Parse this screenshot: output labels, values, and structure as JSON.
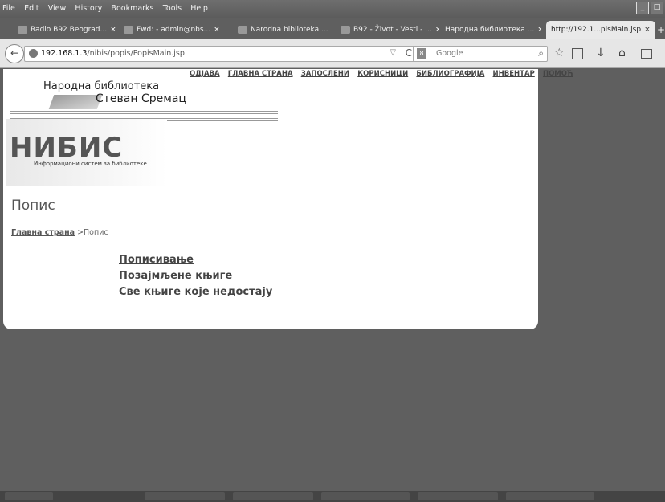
{
  "menubar": [
    "File",
    "Edit",
    "View",
    "History",
    "Bookmarks",
    "Tools",
    "Help"
  ],
  "tabs": [
    {
      "label": "Radio B92 Beograd..."
    },
    {
      "label": "Fwd: - admin@nbs..."
    },
    {
      "label": "Narodna biblioteka ..."
    },
    {
      "label": "B92 - Život - Vesti - ..."
    },
    {
      "label": "Народна библиотека ..."
    },
    {
      "label": "http://192.1...pisMain.jsp"
    }
  ],
  "tab_close": "×",
  "newtab": "+",
  "nav": {
    "url_host": "192.168.1.3",
    "url_path": "/nibis/popis/PopisMain.jsp",
    "search_placeholder": "Google",
    "back": "←",
    "reload": "C",
    "drop": "▽",
    "mag": "⌕",
    "engine": "8",
    "bookmark_star": "☆",
    "download": "↓",
    "home": "⌂"
  },
  "site": {
    "logo_line1": "Народна библиотека",
    "logo_line2": "Стеван Сремац",
    "big_logo": "НИБИС",
    "tagline": "Информациони систем за библиотеке",
    "topnav": [
      "ОДЈАВА",
      "ГЛАВНА СТРАНА",
      "ЗАПОСЛЕНИ",
      "КОРИСНИЦИ",
      "БИБЛИОГРАФИЈА",
      "ИНВЕНТАР",
      "ПОМОЋ"
    ]
  },
  "page": {
    "title": "Попис",
    "crumb_home": "Главна страна",
    "crumb_sep": ">Попис",
    "links": [
      "Пописивање",
      "Позајмљене књиге",
      "Све књиге које недостају"
    ]
  }
}
